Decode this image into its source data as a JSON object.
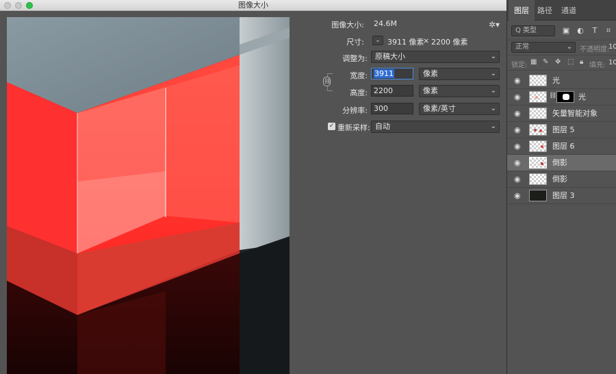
{
  "dialog": {
    "title": "图像大小",
    "image_size_label": "图像大小:",
    "image_size_value": "24.6M",
    "dimensions_label": "尺寸:",
    "dimensions_width": "3911 像素",
    "dimensions_times": "×",
    "dimensions_height": "2200 像素",
    "fit_to_label": "调整为:",
    "fit_to_value": "原稿大小",
    "width_label": "宽度:",
    "width_value": "3911",
    "width_unit": "像素",
    "height_label": "高度:",
    "height_value": "2200",
    "height_unit": "像素",
    "resolution_label": "分辨率:",
    "resolution_value": "300",
    "resolution_unit": "像素/英寸",
    "resample_label": "重新采样:",
    "resample_checked": true,
    "resample_value": "自动",
    "icons": {
      "gear": "gear-icon",
      "link": "chain-link-icon",
      "dropdown": "chevron-down-icon"
    }
  },
  "panel": {
    "tabs": [
      "图层",
      "路径",
      "通道"
    ],
    "active_tab": "图层",
    "filter_label": "Q 类型",
    "blend_mode": "正常",
    "opacity_label": "不透明度:",
    "opacity_value": "10",
    "lock_label": "锁定:",
    "fill_label": "填充:",
    "fill_value": "10",
    "layers": [
      {
        "name": "光",
        "thumb": "transparent",
        "mask": false
      },
      {
        "name": "光",
        "thumb": "transparent",
        "mask": true
      },
      {
        "name": "矢量智能对象",
        "thumb": "transparent",
        "mask": false
      },
      {
        "name": "图层 5",
        "thumb": "transparent",
        "mask": false
      },
      {
        "name": "图层 6",
        "thumb": "transparent",
        "mask": false
      },
      {
        "name": "倒影",
        "thumb": "transparent",
        "mask": false,
        "active": true
      },
      {
        "name": "倒影",
        "thumb": "transparent",
        "mask": false
      },
      {
        "name": "图层 3",
        "thumb": "dark",
        "mask": false
      }
    ]
  },
  "colors": {
    "panel_bg": "#535353",
    "accent_selection": "#2f6cd1",
    "cube_red": "#ff3b3b",
    "traffic_green": "#2ec24a"
  }
}
